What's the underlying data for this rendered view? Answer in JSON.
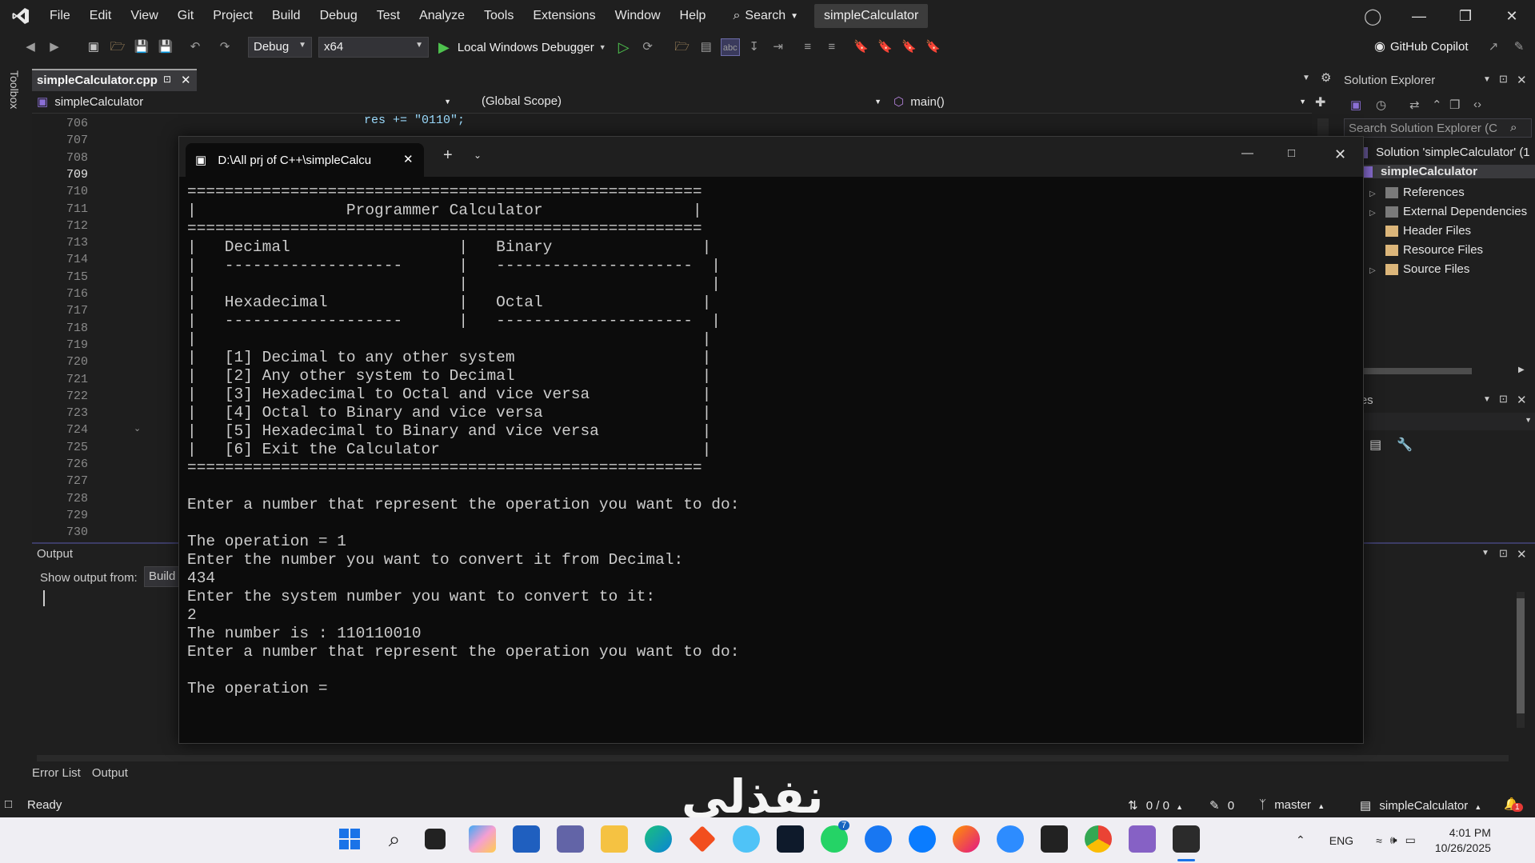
{
  "menu": [
    "File",
    "Edit",
    "View",
    "Git",
    "Project",
    "Build",
    "Debug",
    "Test",
    "Analyze",
    "Tools",
    "Extensions",
    "Window",
    "Help"
  ],
  "search_label": "Search",
  "solution_title": "simpleCalculator",
  "toolbar": {
    "config": "Debug",
    "platform": "x64",
    "debugger": "Local Windows Debugger",
    "copilot": "GitHub Copilot"
  },
  "toolbox_label": "Toolbox",
  "editor": {
    "tab": "simpleCalculator.cpp",
    "nav_project": "simpleCalculator",
    "nav_scope": "(Global Scope)",
    "nav_func": "main()",
    "line_numbers": [
      "706",
      "707",
      "708",
      "709",
      "710",
      "711",
      "712",
      "713",
      "714",
      "715",
      "716",
      "717",
      "718",
      "719",
      "720",
      "721",
      "722",
      "723",
      "724",
      "725",
      "726",
      "727",
      "728",
      "729",
      "730"
    ],
    "current_line": "709",
    "code_first": "res += \"0110\";"
  },
  "solution_explorer": {
    "title": "Solution Explorer",
    "search_placeholder": "Search Solution Explorer (C",
    "solution": "Solution 'simpleCalculator' (1",
    "project": "simpleCalculator",
    "items": [
      "References",
      "External Dependencies",
      "Header Files",
      "Resource Files",
      "Source Files"
    ]
  },
  "properties_title": "erties",
  "output": {
    "title": "Output",
    "show_from": "Show output from:",
    "source": "Build"
  },
  "bottom_tabs": [
    "Error List",
    "Output"
  ],
  "status": {
    "ready": "Ready",
    "changes": "0 / 0",
    "edits": "0",
    "branch": "master",
    "repo": "simpleCalculator"
  },
  "terminal": {
    "tab_title": "D:\\All prj of C++\\simpleCalcu",
    "lines": [
      "=======================================================",
      "|                Programmer Calculator                |",
      "=======================================================",
      "|   Decimal                  |   Binary                |",
      "|   -------------------      |   ---------------------  |",
      "|                            |                          |",
      "|   Hexadecimal              |   Octal                 |",
      "|   -------------------      |   ---------------------  |",
      "|                                                      |",
      "|   [1] Decimal to any other system                    |",
      "|   [2] Any other system to Decimal                    |",
      "|   [3] Hexadecimal to Octal and vice versa            |",
      "|   [4] Octal to Binary and vice versa                 |",
      "|   [5] Hexadecimal to Binary and vice versa           |",
      "|   [6] Exit the Calculator                            |",
      "=======================================================",
      "",
      "Enter a number that represent the operation you want to do:",
      "",
      "The operation = 1",
      "Enter the number you want to convert it from Decimal:",
      "434",
      "Enter the system number you want to convert to it:",
      "2",
      "The number is : 110110010",
      "Enter a number that represent the operation you want to do:",
      "",
      "The operation = "
    ]
  },
  "taskbar": {
    "lang": "ENG",
    "time": "4:01 PM",
    "date": "10/26/2025",
    "whatsapp_badge": "7",
    "notif_badge": "1"
  },
  "watermark": "نفذلي",
  "colors": {
    "accent": "#8b6fd6",
    "string": "#d69d85",
    "keyword": "#9cdcfe",
    "play": "#4ec24e"
  }
}
